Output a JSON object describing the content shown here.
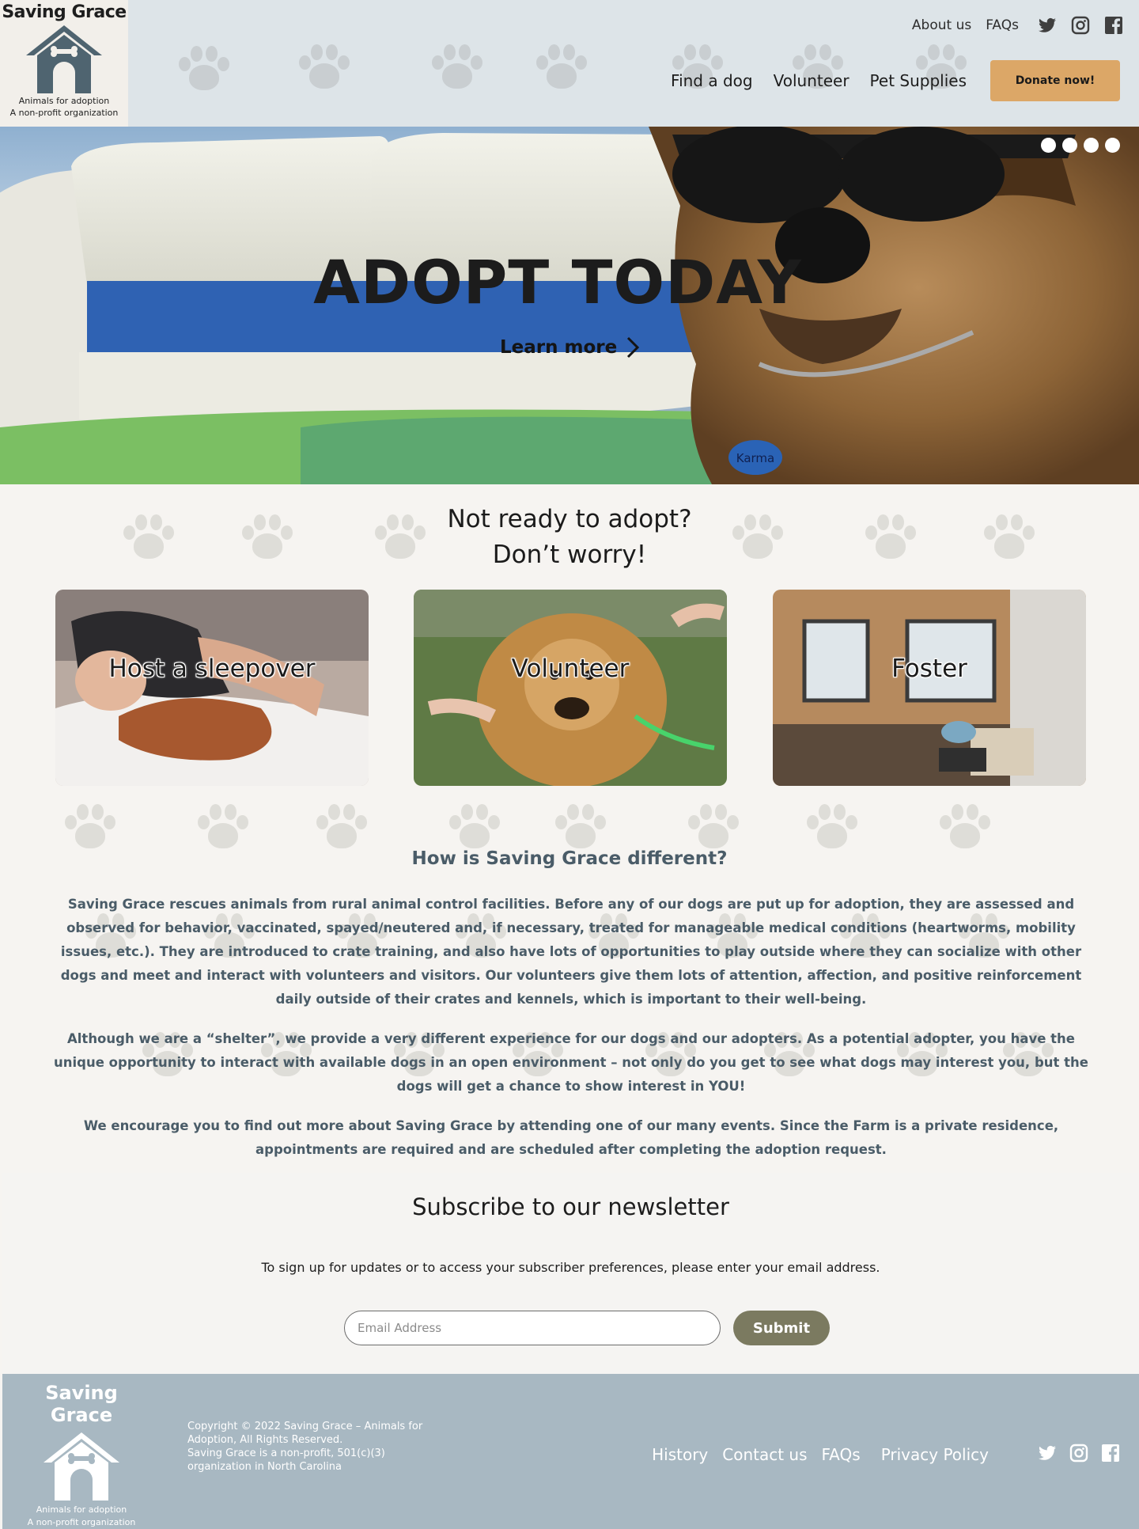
{
  "header": {
    "logo": {
      "title": "Saving Grace",
      "subtitle_1": "Animals for adoption",
      "subtitle_2": "A non-profit organization"
    },
    "top_links": [
      "About us",
      "FAQs"
    ],
    "social_icons": [
      "twitter-icon",
      "instagram-icon",
      "facebook-icon"
    ],
    "nav": [
      "Find a dog",
      "Volunteer",
      "Pet Supplies"
    ],
    "donate_label": "Donate now!"
  },
  "hero": {
    "title": "ADOPT TODAY",
    "link_label": "Learn more",
    "slide_count": 4,
    "tag_text": "Karma"
  },
  "alt_section": {
    "heading_line1": "Not ready to adopt?",
    "heading_line2": "Don’t worry!",
    "cards": [
      {
        "label": "Host a sleepover"
      },
      {
        "label": "Volunteer"
      },
      {
        "label": "Foster"
      }
    ]
  },
  "difference": {
    "title": "How is Saving Grace different?",
    "paragraphs": [
      "Saving Grace rescues animals from rural animal control facilities. Before any of our dogs are put up for adoption, they are assessed and observed for behavior, vaccinated, spayed/neutered and, if necessary, treated for manageable medical conditions (heartworms, mobility issues, etc.). They are introduced to crate training, and also have lots of opportunities to play outside where they can socialize with other dogs and meet and interact with volunteers and visitors. Our volunteers give them lots of attention, affection, and positive reinforcement daily outside of their crates and kennels, which is important to their well-being.",
      "Although we are a “shelter”, we provide a very different experience for our dogs and our adopters. As a potential adopter, you have the unique opportunity to interact with available dogs in an open environment – not only do you get to see what dogs may interest you, but the dogs will get a chance to show interest in YOU!",
      "We encourage you to find out more about Saving Grace by attending one of our many events. Since the Farm is a private residence, appointments are required and are scheduled after completing the adoption request."
    ]
  },
  "newsletter": {
    "title": "Subscribe to our newsletter",
    "text": "To sign up for updates or to access your subscriber preferences, please enter your email address.",
    "email_placeholder": "Email Address",
    "submit_label": "Submit"
  },
  "footer": {
    "logo": {
      "title": "Saving Grace",
      "subtitle_1": "Animals for adoption",
      "subtitle_2": "A non-profit organization"
    },
    "copyright_1": "Copyright © 2022 Saving Grace – Animals for Adoption, All Rights Reserved.",
    "copyright_2": "Saving Grace is a non-profit, 501(c)(3) organization in North Carolina",
    "links": [
      "History",
      "Contact us",
      "FAQs",
      "Privacy Policy"
    ],
    "social_icons": [
      "twitter-icon",
      "instagram-icon",
      "facebook-icon"
    ]
  },
  "colors": {
    "header_bg": "#dde4e8",
    "donate": "#dca767",
    "text_slate": "#4a5c68",
    "submit": "#7b7a60",
    "footer_bg": "#a8b8c2"
  }
}
